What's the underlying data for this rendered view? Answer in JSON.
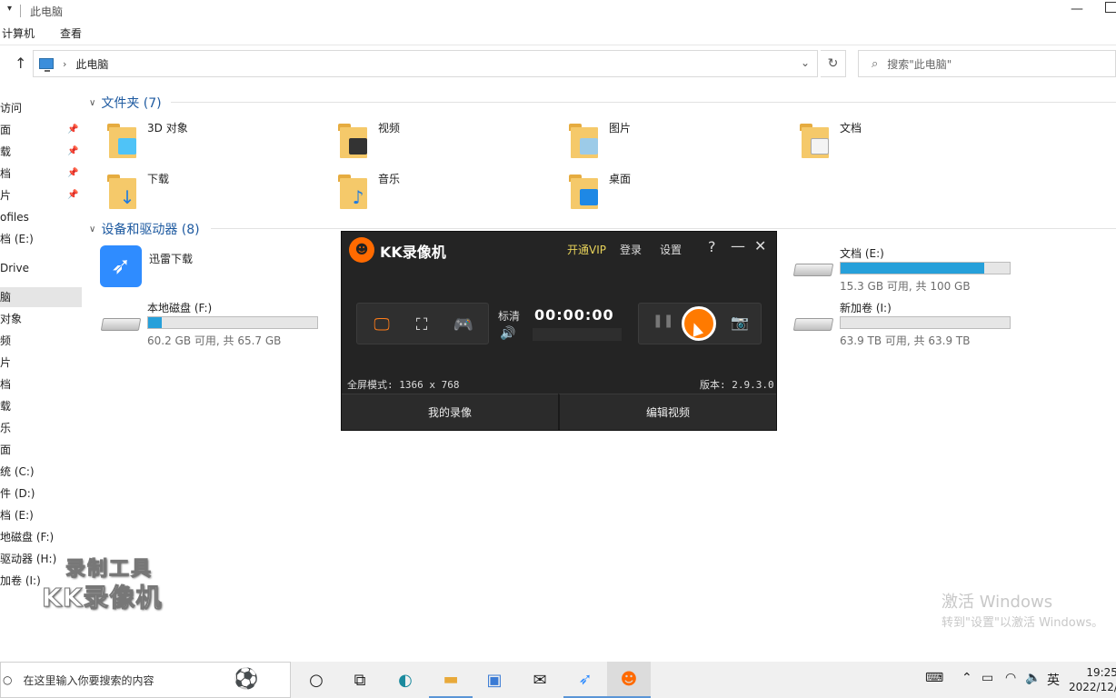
{
  "window": {
    "title": "此电脑",
    "ribbon_tabs": [
      "计算机",
      "查看"
    ]
  },
  "address": {
    "path": "此电脑",
    "search_placeholder": "搜索\"此电脑\""
  },
  "sidebar": {
    "items": [
      {
        "label": "访问",
        "pinned": false
      },
      {
        "label": "面",
        "pinned": true
      },
      {
        "label": "载",
        "pinned": true
      },
      {
        "label": "档",
        "pinned": true
      },
      {
        "label": "片",
        "pinned": true
      },
      {
        "label": "ofiles",
        "pinned": false
      },
      {
        "label": "档 (E:)",
        "pinned": false
      },
      {
        "label": "Drive",
        "pinned": false
      },
      {
        "label": "脑",
        "pinned": false,
        "selected": true
      },
      {
        "label": "对象",
        "pinned": false
      },
      {
        "label": "频",
        "pinned": false
      },
      {
        "label": "片",
        "pinned": false
      },
      {
        "label": "档",
        "pinned": false
      },
      {
        "label": "载",
        "pinned": false
      },
      {
        "label": "乐",
        "pinned": false
      },
      {
        "label": "面",
        "pinned": false
      },
      {
        "label": "统 (C:)",
        "pinned": false
      },
      {
        "label": "件 (D:)",
        "pinned": false
      },
      {
        "label": "档 (E:)",
        "pinned": false
      },
      {
        "label": "地磁盘 (F:)",
        "pinned": false
      },
      {
        "label": "驱动器 (H:)",
        "pinned": false
      },
      {
        "label": "加卷 (I:)",
        "pinned": false
      }
    ]
  },
  "folders_section": {
    "title": "文件夹 (7)",
    "items": [
      {
        "label": "3D 对象",
        "icon": "3d-objects-folder-icon"
      },
      {
        "label": "视频",
        "icon": "videos-folder-icon"
      },
      {
        "label": "图片",
        "icon": "pictures-folder-icon"
      },
      {
        "label": "文档",
        "icon": "documents-folder-icon"
      },
      {
        "label": "下载",
        "icon": "downloads-folder-icon"
      },
      {
        "label": "音乐",
        "icon": "music-folder-icon"
      },
      {
        "label": "桌面",
        "icon": "desktop-folder-icon"
      }
    ]
  },
  "devices_section": {
    "title": "设备和驱动器 (8)",
    "app_item": {
      "label": "迅雷下载",
      "icon": "xunlei-bird-icon"
    },
    "drives": [
      {
        "name": "本地磁盘 (F:)",
        "free_text": "60.2 GB 可用, 共 65.7 GB",
        "used_fraction": 0.08
      },
      {
        "name": "文档 (E:)",
        "free_text": "15.3 GB 可用, 共 100 GB",
        "used_fraction": 0.85
      },
      {
        "name": "新加卷 (I:)",
        "free_text": "63.9 TB 可用, 共 63.9 TB",
        "used_fraction": 0.0
      }
    ]
  },
  "kk": {
    "title": "KK录像机",
    "vip": "开通VIP",
    "login": "登录",
    "settings": "设置",
    "help": "?",
    "quality": "标清",
    "timer": "00:00:00",
    "mode_info": "全屏模式: 1366 x 768",
    "version": "版本: 2.9.3.0",
    "my_recordings": "我的录像",
    "edit_video": "编辑视频"
  },
  "watermark": {
    "line1": "录制工具",
    "line2": "KK录像机"
  },
  "activation": {
    "line1": "激活 Windows",
    "line2": "转到\"设置\"以激活 Windows。"
  },
  "taskbar": {
    "search_text": "在这里输入你要搜索的内容",
    "input_lang": "英",
    "time": "19:25",
    "date": "2022/12/"
  }
}
